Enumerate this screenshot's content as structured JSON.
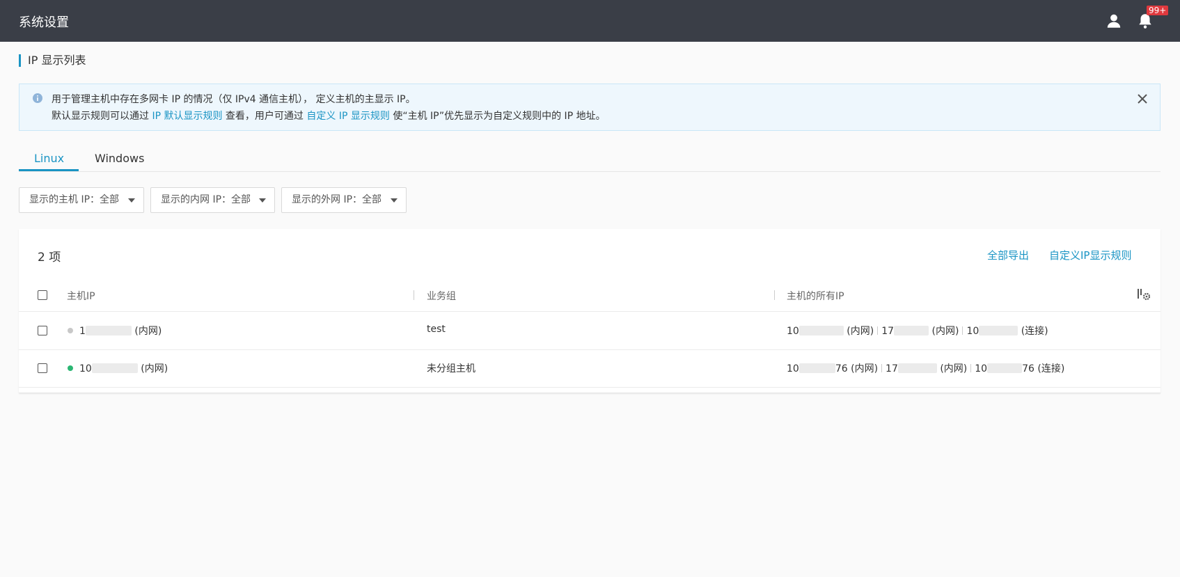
{
  "header": {
    "title": "系统设置",
    "notification_badge": "99+",
    "icons": [
      "user-icon",
      "bell-icon"
    ],
    "bg_color": "#3a3e47"
  },
  "page": {
    "heading": "IP 显示列表",
    "accent_color": "#1a94c4"
  },
  "alert": {
    "line1": "用于管理主机中存在多网卡 IP 的情况（仅 IPv4 通信主机）， 定义主机的主显示 IP。",
    "line2_prefix": "默认显示规则可以通过 ",
    "line2_link1": "IP 默认显示规则",
    "line2_middle": " 查看，用户可通过 ",
    "line2_link2": "自定义 IP 显示规则",
    "line2_suffix": " 使“主机 IP”优先显示为自定义规则中的 IP 地址。"
  },
  "tabs": [
    {
      "label": "Linux",
      "active": true
    },
    {
      "label": "Windows",
      "active": false
    }
  ],
  "filters": [
    {
      "label": "显示的主机 IP：全部"
    },
    {
      "label": "显示的内网 IP：全部"
    },
    {
      "label": "显示的外网 IP：全部"
    }
  ],
  "table": {
    "count_label": "2 项",
    "export_label": "全部导出",
    "custom_rule_label": "自定义IP显示规则",
    "columns": [
      "主机IP",
      "业务组",
      "主机的所有IP"
    ],
    "rows": [
      {
        "status_color": "#c8c8c8",
        "host_ip_prefix": "1",
        "host_ip_suffix": "(内网)",
        "group": "test",
        "ip1_prefix": "10",
        "ip1_tag": "(内网)",
        "ip2_prefix": "17",
        "ip2_tag": "(内网)",
        "ip3_prefix": "10",
        "ip3_tag": "(连接)"
      },
      {
        "status_color": "#2bb673",
        "host_ip_prefix": "10",
        "host_ip_suffix": "(内网)",
        "group": "未分组主机",
        "ip1_prefix": "10",
        "ip1_tail": "76",
        "ip1_tag": "(内网)",
        "ip2_prefix": "17",
        "ip2_tag": "(内网)",
        "ip3_prefix": "10",
        "ip3_tail": "76",
        "ip3_tag": "(连接)"
      }
    ]
  }
}
